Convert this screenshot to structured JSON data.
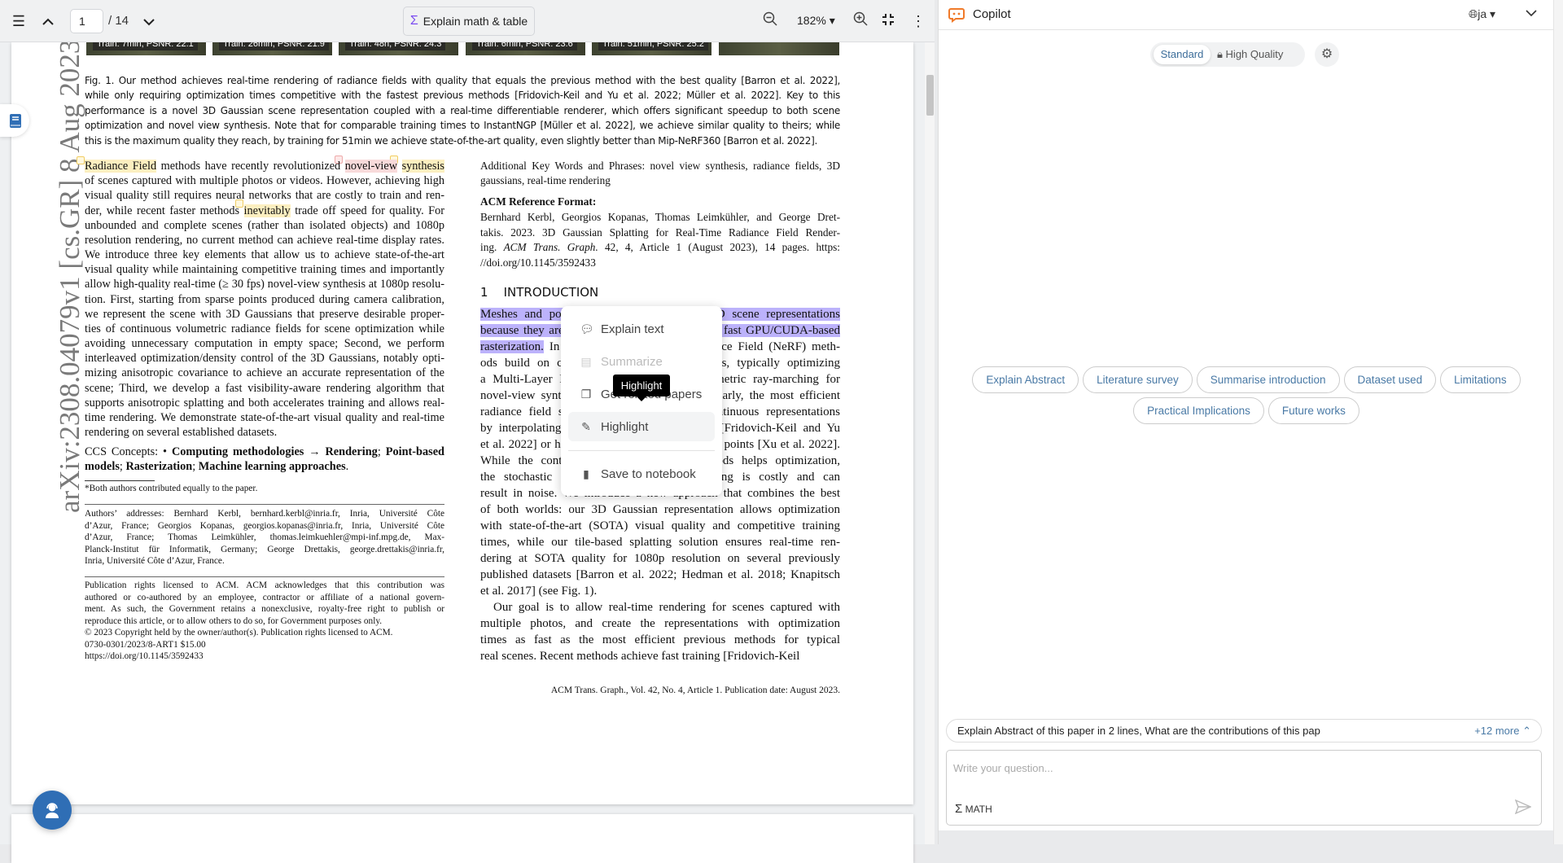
{
  "toolbar": {
    "page_current": "1",
    "page_total": "/ 14",
    "explain_label": "Explain math & table",
    "zoom": "182%"
  },
  "figure_tiles": [
    "Train: 7min, PSNR: 22.1",
    "Train: 26min, PSNR: 21.9",
    "Train: 48h, PSNR: 24.3",
    "Train: 6min, PSNR: 23.6",
    "Train: 51min, PSNR: 25.2"
  ],
  "arxiv_stamp": "arXiv:2308.04079v1  [cs.GR]  8 Aug 2023",
  "caption": [
    "Fig. 1.   Our method achieves real-time rendering of radiance fields with quality that equals the previous method with the best quality [Barron et al. 2022],",
    "while only requiring optimization times competitive with the fastest previous methods [Fridovich-Keil and Yu et al. 2022; Müller et al. 2022]. Key to this",
    "performance is a novel 3D Gaussian scene representation coupled with a real-time differentiable renderer, which offers significant speedup to both scene",
    "optimization and novel view synthesis. Note that for comparable training times to InstantNGP [Müller et al. 2022], we achieve similar quality to theirs; while",
    "this is the maximum quality they reach, by training for 51min we achieve state-of-the-art quality, even slightly better than Mip-NeRF360 [Barron et al. 2022]."
  ],
  "abstract": [
    [
      {
        "t": "Radiance Field",
        "c": "hy"
      },
      {
        "t": " methods have recently revolutionized "
      },
      {
        "t": "novel-view",
        "c": "hp"
      },
      {
        "t": " "
      },
      {
        "t": "synthesis",
        "c": "hy"
      }
    ],
    "of scenes captured with multiple photos or videos. However, achieving high",
    "visual quality still requires neural networks that are costly to train and ren-",
    [
      {
        "t": "der, while recent faster methods "
      },
      {
        "t": "inevitably",
        "c": "hy"
      },
      {
        "t": " trade off speed for quality. For"
      }
    ],
    "unbounded and complete scenes (rather than isolated objects) and 1080p",
    "resolution rendering, no current method can achieve real-time display rates.",
    "We introduce three key elements that allow us to achieve state-of-the-art",
    "visual quality while maintaining competitive training times and importantly",
    "allow high-quality real-time (≥ 30 fps) novel-view synthesis at 1080p resolu-",
    "tion. First, starting from sparse points produced during camera calibration,",
    "we represent the scene with 3D Gaussians that preserve desirable proper-",
    "ties of continuous volumetric radiance fields for scene optimization while",
    "avoiding unnecessary computation in empty space; Second, we perform",
    "interleaved optimization/density control of the 3D Gaussians, notably opti-",
    "mizing anisotropic covariance to achieve an accurate representation of the",
    "scene; Third, we develop a fast visibility-aware rendering algorithm that",
    "supports anisotropic splatting and both accelerates training and allows real-",
    "time rendering. We demonstrate state-of-the-art visual quality and real-time",
    "rendering on several established datasets."
  ],
  "ccs": [
    [
      {
        "t": "CCS Concepts: • "
      },
      {
        "t": "Computing methodologies",
        "c": "b"
      },
      {
        "t": " → "
      },
      {
        "t": "Rendering",
        "c": "b"
      },
      {
        "t": "; "
      },
      {
        "t": "Point-based",
        "c": "b"
      }
    ],
    [
      {
        "t": "models",
        "c": "b"
      },
      {
        "t": "; "
      },
      {
        "t": "Rasterization",
        "c": "b"
      },
      {
        "t": "; "
      },
      {
        "t": "Machine learning approaches",
        "c": "b"
      },
      {
        "t": "."
      }
    ]
  ],
  "footnote_equal": "*Both authors contributed equally to the paper.",
  "authors": [
    "Authors’ addresses: Bernhard Kerbl, bernhard.kerbl@inria.fr, Inria, Université Côte",
    "d’Azur, France; Georgios Kopanas, georgios.kopanas@inria.fr, Inria, Université Côte",
    "d’Azur,  France;  Thomas  Leimkühler,  thomas.leimkuehler@mpi-inf.mpg.de,  Max-",
    "Planck-Institut für Informatik, Germany; George Drettakis, george.drettakis@inria.fr,",
    "Inria, Université Côte d’Azur, France."
  ],
  "rights": [
    "Publication rights licensed to ACM. ACM acknowledges that this contribution was",
    "authored or co-authored by an employee, contractor or affiliate of a national govern-",
    "ment. As such, the Government retains a nonexclusive, royalty-free right to publish or",
    "reproduce this article, or to allow others to do so, for Government purposes only.",
    "© 2023 Copyright held by the owner/author(s). Publication rights licensed to ACM.",
    "0730-0301/2023/8-ART1 $15.00",
    "https://doi.org/10.1145/3592433"
  ],
  "keywords": [
    "Additional Key Words and Phrases: novel view synthesis, radiance fields, 3D",
    "gaussians, real-time rendering"
  ],
  "acm_ref_title": "ACM Reference Format:",
  "acm_ref": [
    "Bernhard Kerbl, Georgios Kopanas, Thomas Leimkühler, and George Dret-",
    "takis. 2023. 3D Gaussian Splatting for Real-Time Radiance Field Render-",
    [
      {
        "t": "ing. "
      },
      {
        "t": "ACM Trans. Graph.",
        "c": "i"
      },
      {
        "t": " 42, 4, Article 1 (August 2023), 14 pages. https:"
      }
    ],
    "//doi.org/10.1145/3592433"
  ],
  "intro_heading": "1    INTRODUCTION",
  "intro": [
    [
      {
        "t": "Meshes and points are the most common 3D scene representations",
        "c": "sel"
      }
    ],
    [
      {
        "t": "because they are explicit and are a good fit for fast GPU/CUDA-based",
        "c": "sel"
      }
    ],
    [
      {
        "t": "rasterization.",
        "c": "sel"
      },
      {
        "t": " In contrast, recent Neural Radiance Field (NeRF) meth-"
      }
    ],
    "ods build on continuous scene representations, typically optimizing",
    "a Multi-Layer Perceptron (MLP) using volumetric ray-marching for",
    "novel-view synthesis of captured scenes. Similarly, the most efficient",
    "radiance field solutions to date build on continuous representations",
    "by interpolating values stored in, e.g., voxel [Fridovich-Keil and Yu",
    "et al. 2022] or hash [Müller et al. 2022] grids or points [Xu et al. 2022].",
    "While the continuous nature of these methods helps optimization,",
    "the stochastic sampling required for rendering is costly and can",
    "result in noise. We introduce a new approach that combines the best",
    "of both worlds: our 3D Gaussian representation allows optimization",
    "with state-of-the-art (SOTA) visual quality and competitive training",
    "times, while our tile-based splatting solution ensures real-time ren-",
    "dering at SOTA quality for 1080p resolution on several previously",
    "published datasets [Barron et al. 2022; Hedman et al. 2018; Knapitsch",
    "et al. 2017] (see Fig. 1).",
    "Our goal is to allow real-time rendering for scenes captured with",
    "multiple photos, and create the representations with optimization",
    "times as fast as the most efficient previous methods for typical",
    "real scenes. Recent methods achieve fast training [Fridovich-Keil"
  ],
  "page_footer": "ACM Trans. Graph., Vol. 42, No. 4, Article 1. Publication date: August 2023.",
  "context_menu": {
    "items": [
      "Explain text",
      "Summarize",
      "Get related papers",
      "Highlight",
      "Save to notebook"
    ],
    "tooltip": "Highlight"
  },
  "copilot": {
    "title": "Copilot",
    "language": "ja",
    "modes": [
      "Standard",
      "High Quality"
    ],
    "chips_row1": [
      "Explain Abstract",
      "Literature survey",
      "Summarise introduction",
      "Dataset used",
      "Limitations"
    ],
    "chips_row2": [
      "Practical Implications",
      "Future works"
    ],
    "suggestion": "Explain Abstract of this paper in 2 lines, What are the contributions of this pap",
    "suggestion_more": "+12 more",
    "input_placeholder": "Write your question...",
    "math_label": "MATH"
  },
  "colors": {
    "accent": "#7b4cf0",
    "link": "#4a7aa6",
    "support": "#2f6eb5",
    "brand": "#f07a2a"
  }
}
